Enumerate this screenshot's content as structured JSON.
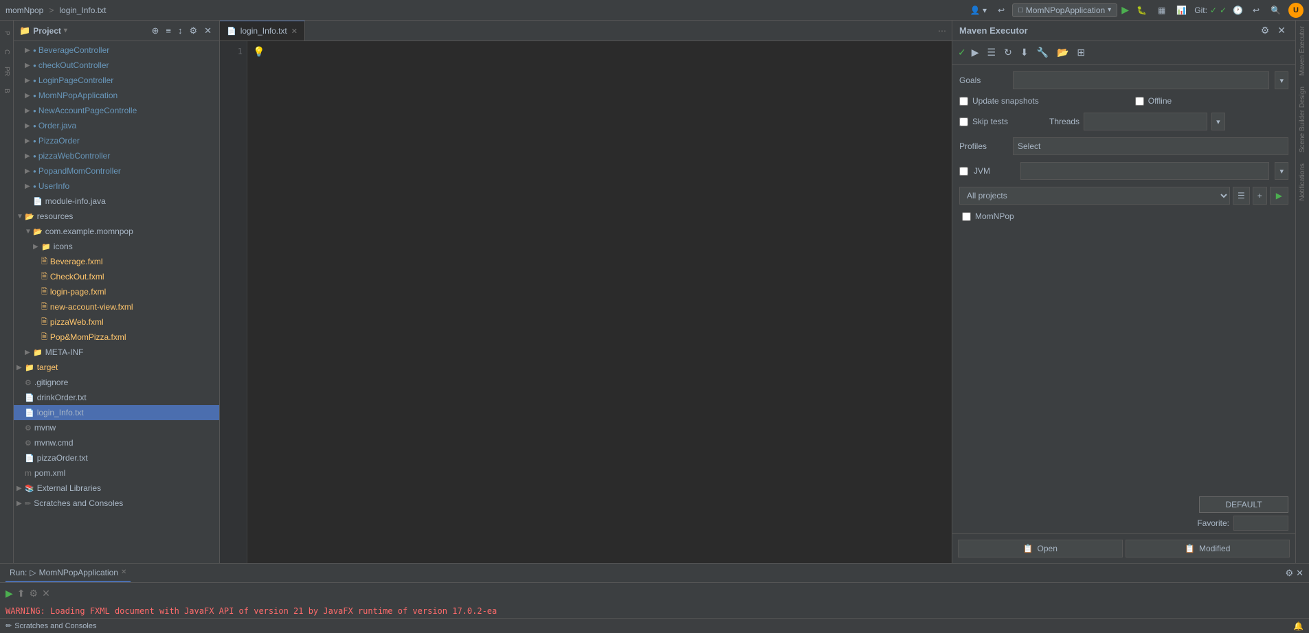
{
  "topbar": {
    "project": "momNpop",
    "separator": ">",
    "file": "login_Info.txt",
    "run_config": "MomNPopApplication",
    "git_label": "Git:",
    "avatar_text": "U"
  },
  "project_panel": {
    "title": "Project",
    "items": [
      {
        "label": "BeverageController",
        "type": "class",
        "indent": 1
      },
      {
        "label": "checkOutController",
        "type": "class",
        "indent": 1
      },
      {
        "label": "LoginPageController",
        "type": "class",
        "indent": 1
      },
      {
        "label": "MomNPopApplication",
        "type": "class",
        "indent": 1
      },
      {
        "label": "NewAccountPageControlle",
        "type": "class",
        "indent": 1
      },
      {
        "label": "Order.java",
        "type": "java",
        "indent": 1
      },
      {
        "label": "PizzaOrder",
        "type": "class",
        "indent": 1
      },
      {
        "label": "pizzaWebController",
        "type": "class",
        "indent": 1
      },
      {
        "label": "PopandMomController",
        "type": "class",
        "indent": 1
      },
      {
        "label": "UserInfo",
        "type": "class",
        "indent": 1
      },
      {
        "label": "module-info.java",
        "type": "java",
        "indent": 1
      },
      {
        "label": "resources",
        "type": "folder",
        "indent": 0
      },
      {
        "label": "com.example.momnpop",
        "type": "folder",
        "indent": 1
      },
      {
        "label": "icons",
        "type": "folder",
        "indent": 2
      },
      {
        "label": "Beverage.fxml",
        "type": "fxml",
        "indent": 2
      },
      {
        "label": "CheckOut.fxml",
        "type": "fxml",
        "indent": 2
      },
      {
        "label": "login-page.fxml",
        "type": "fxml",
        "indent": 2
      },
      {
        "label": "new-account-view.fxml",
        "type": "fxml",
        "indent": 2
      },
      {
        "label": "pizzaWeb.fxml",
        "type": "fxml",
        "indent": 2
      },
      {
        "label": "Pop&MomPizza.fxml",
        "type": "fxml",
        "indent": 2
      },
      {
        "label": "META-INF",
        "type": "folder",
        "indent": 1
      },
      {
        "label": "target",
        "type": "folder_orange",
        "indent": 0
      },
      {
        "label": ".gitignore",
        "type": "file",
        "indent": 0
      },
      {
        "label": "drinkOrder.txt",
        "type": "txt",
        "indent": 0
      },
      {
        "label": "login_Info.txt",
        "type": "txt",
        "indent": 0,
        "selected": true
      },
      {
        "label": "mvnw",
        "type": "file",
        "indent": 0
      },
      {
        "label": "mvnw.cmd",
        "type": "file",
        "indent": 0
      },
      {
        "label": "pizzaOrder.txt",
        "type": "txt",
        "indent": 0
      },
      {
        "label": "pom.xml",
        "type": "xml",
        "indent": 0
      },
      {
        "label": "External Libraries",
        "type": "library",
        "indent": 0
      },
      {
        "label": "Scratches and Consoles",
        "type": "scratch",
        "indent": 0
      }
    ]
  },
  "editor": {
    "tab_label": "login_Info.txt",
    "line_number": "1",
    "content": ""
  },
  "maven": {
    "title": "Maven Executor",
    "goals_label": "Goals",
    "update_snapshots_label": "Update snapshots",
    "offline_label": "Offline",
    "skip_tests_label": "Skip tests",
    "threads_label": "Threads",
    "profiles_label": "Profiles",
    "profiles_placeholder": "Select",
    "jvm_label": "JVM",
    "all_projects_label": "All projects",
    "momnpop_label": "MomNPop",
    "default_btn_label": "DEFAULT",
    "favorite_label": "Favorite:",
    "open_btn_label": "Open",
    "modified_btn_label": "Modified"
  },
  "bottom": {
    "run_tab_label": "Run:",
    "run_config_label": "MomNPopApplication",
    "warning_text": "WARNING: Loading FXML document with JavaFX API of version 21 by JavaFX runtime of version 17.0.2-ea"
  },
  "right_sidebar": {
    "maven_label": "Maven",
    "notifications_label": "Notifications"
  }
}
